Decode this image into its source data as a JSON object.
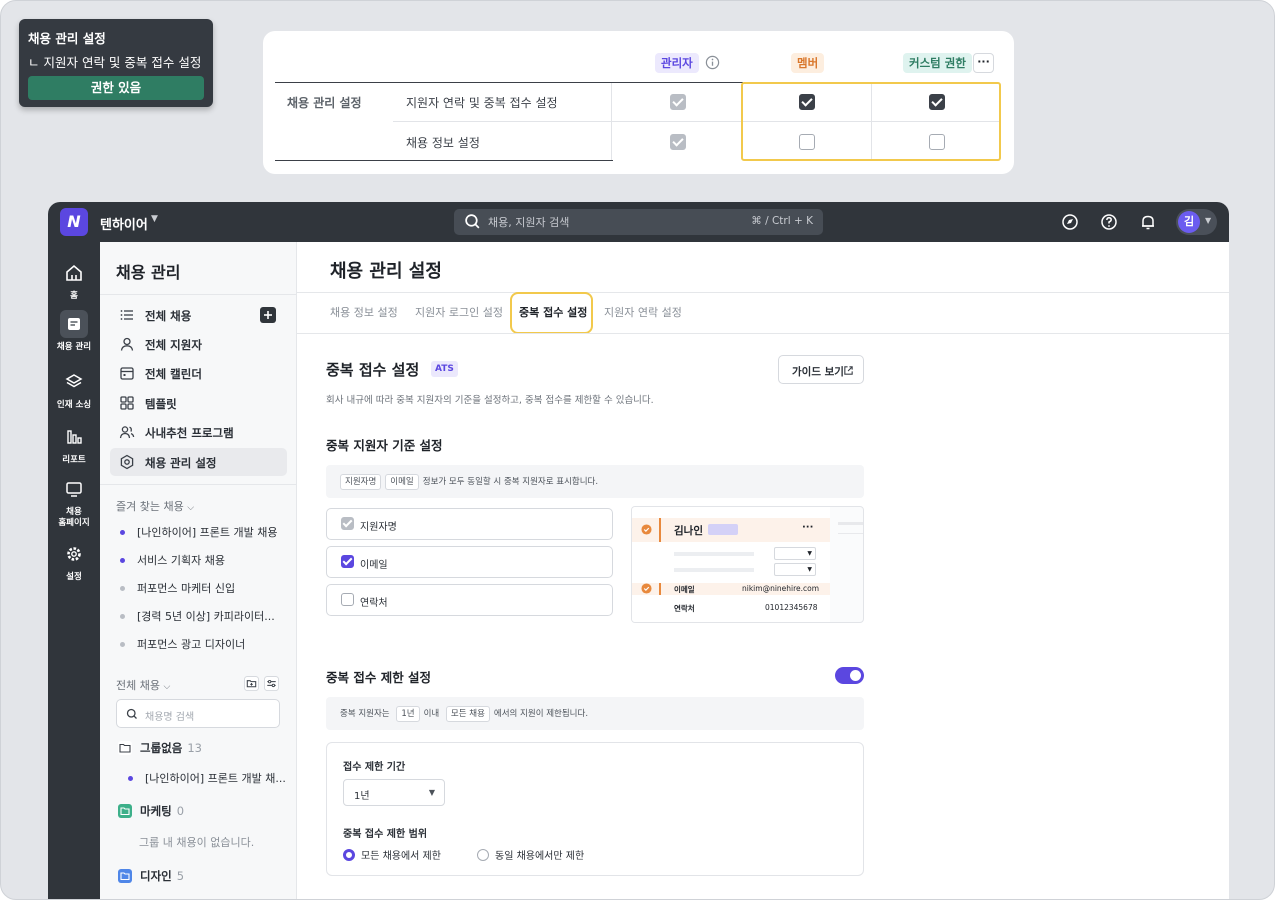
{
  "tooltip": {
    "title": "채용 관리 설정",
    "item": "ㄴ 지원자 연락 및 중복 접수 설정",
    "status": "권한 있음"
  },
  "permissions": {
    "roles": [
      "관리자",
      "멤버",
      "커스텀 권한"
    ],
    "more_label": "···",
    "group": "채용 관리 설정",
    "rows": [
      {
        "label": "지원자 연락 및 중복 접수 설정",
        "admin": true,
        "member": true,
        "custom": true
      },
      {
        "label": "채용 정보 설정",
        "admin": true,
        "member": false,
        "custom": false
      }
    ],
    "colors": {
      "admin_bg": "#ece9fd",
      "admin_fg": "#5b47e0",
      "member_bg": "#fdeedf",
      "member_fg": "#d9772c",
      "custom_bg": "#dff3ef",
      "custom_fg": "#2f7d63"
    }
  },
  "topbar": {
    "brand": "텐하이어",
    "logo_letter": "N",
    "search_placeholder": "채용, 지원자 검색",
    "search_shortcut": "⌘ / Ctrl + K",
    "avatar_initial": "김"
  },
  "rail": [
    {
      "label": "홈",
      "icon": "home-icon"
    },
    {
      "label": "채용 관리",
      "icon": "recruit-icon",
      "active": true
    },
    {
      "label": "인재 소싱",
      "icon": "layers-icon"
    },
    {
      "label": "리포트",
      "icon": "report-icon"
    },
    {
      "label": "채용\n홈페이지",
      "icon": "monitor-icon"
    },
    {
      "label": "설정",
      "icon": "gear-icon"
    }
  ],
  "sidebar": {
    "title": "채용 관리",
    "items": [
      {
        "label": "전체 채용",
        "icon": "list-icon"
      },
      {
        "label": "전체 지원자",
        "icon": "user-icon"
      },
      {
        "label": "전체 캘린더",
        "icon": "calendar-icon"
      },
      {
        "label": "템플릿",
        "icon": "grid-icon"
      },
      {
        "label": "사내추천 프로그램",
        "icon": "users-icon"
      },
      {
        "label": "채용 관리 설정",
        "icon": "settings-icon",
        "active": true
      }
    ],
    "favorites_label": "즐겨 찾는 채용",
    "favorites": [
      {
        "label": "[나인하이어] 프론트 개발 채용",
        "active": true
      },
      {
        "label": "서비스 기획자 채용",
        "active": true
      },
      {
        "label": "퍼포먼스 마케터 신입",
        "active": false
      },
      {
        "label": "[경력 5년 이상] 카피라이터...",
        "active": false
      },
      {
        "label": "퍼포먼스 광고 디자이너",
        "active": false
      }
    ],
    "all_label": "전체 채용",
    "search_placeholder": "채용명 검색",
    "groups": [
      {
        "name": "그룹없음",
        "count": "13",
        "color": "#ffffff"
      },
      {
        "name": "마케팅",
        "count": "0",
        "color": "#3db08a"
      },
      {
        "name": "디자인",
        "count": "5",
        "color": "#4f86e8"
      }
    ],
    "group_job": "[나인하이어] 프론트 개발 채...",
    "empty_group": "그룹 내 채용이 없습니다."
  },
  "main": {
    "title": "채용 관리 설정",
    "tabs": [
      "채용 정보 설정",
      "지원자 로그인 설정",
      "중복 접수 설정",
      "지원자 연락 설정"
    ],
    "section_title": "중복 접수 설정",
    "ats_badge": "ATS",
    "description": "회사 내규에 따라 중복 지원자의 기준을 설정하고, 중복 접수를 제한할 수 있습니다.",
    "guide_button": "가이드 보기",
    "criteria_title": "중복 지원자 기준 설정",
    "criteria_info": {
      "chip1": "지원자명",
      "chip2": "이메일",
      "text": "정보가 모두 동일할 시 중복 지원자로 표시합니다."
    },
    "options": [
      {
        "label": "지원자명",
        "state": "disabled"
      },
      {
        "label": "이메일",
        "state": "checked"
      },
      {
        "label": "연락처",
        "state": "unchecked"
      }
    ],
    "preview": {
      "name": "김나인",
      "email_label": "이메일",
      "email": "nikim@ninehire.com",
      "phone_label": "연락처",
      "phone": "01012345678",
      "more": "···"
    },
    "limit_title": "중복 접수 제한 설정",
    "limit_info": {
      "t1": "중복 지원자는",
      "chip1": "1년",
      "t2": "이내",
      "chip2": "모든 채용",
      "t3": "에서의 지원이 제한됩니다."
    },
    "period_label": "접수 제한 기간",
    "period_value": "1년",
    "scope_label": "중복 접수 제한 범위",
    "scope_options": [
      {
        "label": "모든 채용에서 제한",
        "selected": true
      },
      {
        "label": "동일 채용에서만 제한",
        "selected": false
      }
    ],
    "accent": "#5b47e0"
  }
}
